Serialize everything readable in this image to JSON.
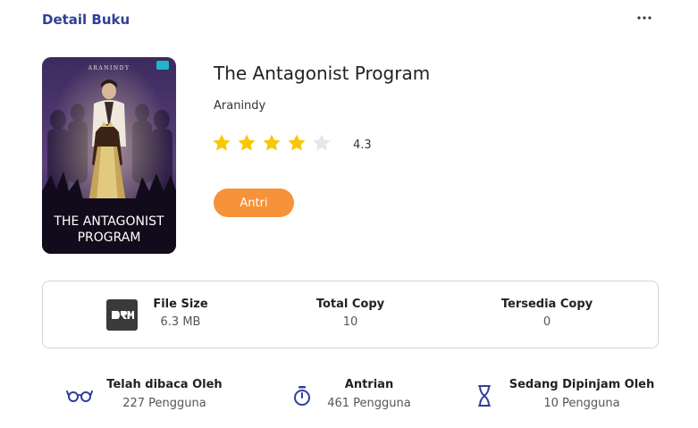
{
  "header": {
    "title": "Detail Buku"
  },
  "book": {
    "cover_publisher": "ARANINDY",
    "cover_title_line1": "THE ANTAGONIST",
    "cover_title_line2": "PROGRAM",
    "title": "The Antagonist Program",
    "author": "Aranindy",
    "rating": 4.3,
    "rating_text": "4.3",
    "stars_filled": 4,
    "stars_total": 5,
    "queue_button": "Antri"
  },
  "info": {
    "icon": "drm-icon",
    "file_size_label": "File Size",
    "file_size_value": "6.3 MB",
    "total_copy_label": "Total Copy",
    "total_copy_value": "10",
    "available_copy_label": "Tersedia Copy",
    "available_copy_value": "0"
  },
  "stats": {
    "read": {
      "icon": "glasses-icon",
      "label": "Telah dibaca Oleh",
      "value": "227 Pengguna"
    },
    "queue": {
      "icon": "stopwatch-icon",
      "label": "Antrian",
      "value": "461 Pengguna"
    },
    "borrowed": {
      "icon": "hourglass-icon",
      "label": "Sedang Dipinjam Oleh",
      "value": "10 Pengguna"
    }
  },
  "colors": {
    "accent_blue": "#2f3f9a",
    "star_filled": "#f7c800",
    "star_empty": "#e6e6e6",
    "button_orange": "#f5923a"
  }
}
